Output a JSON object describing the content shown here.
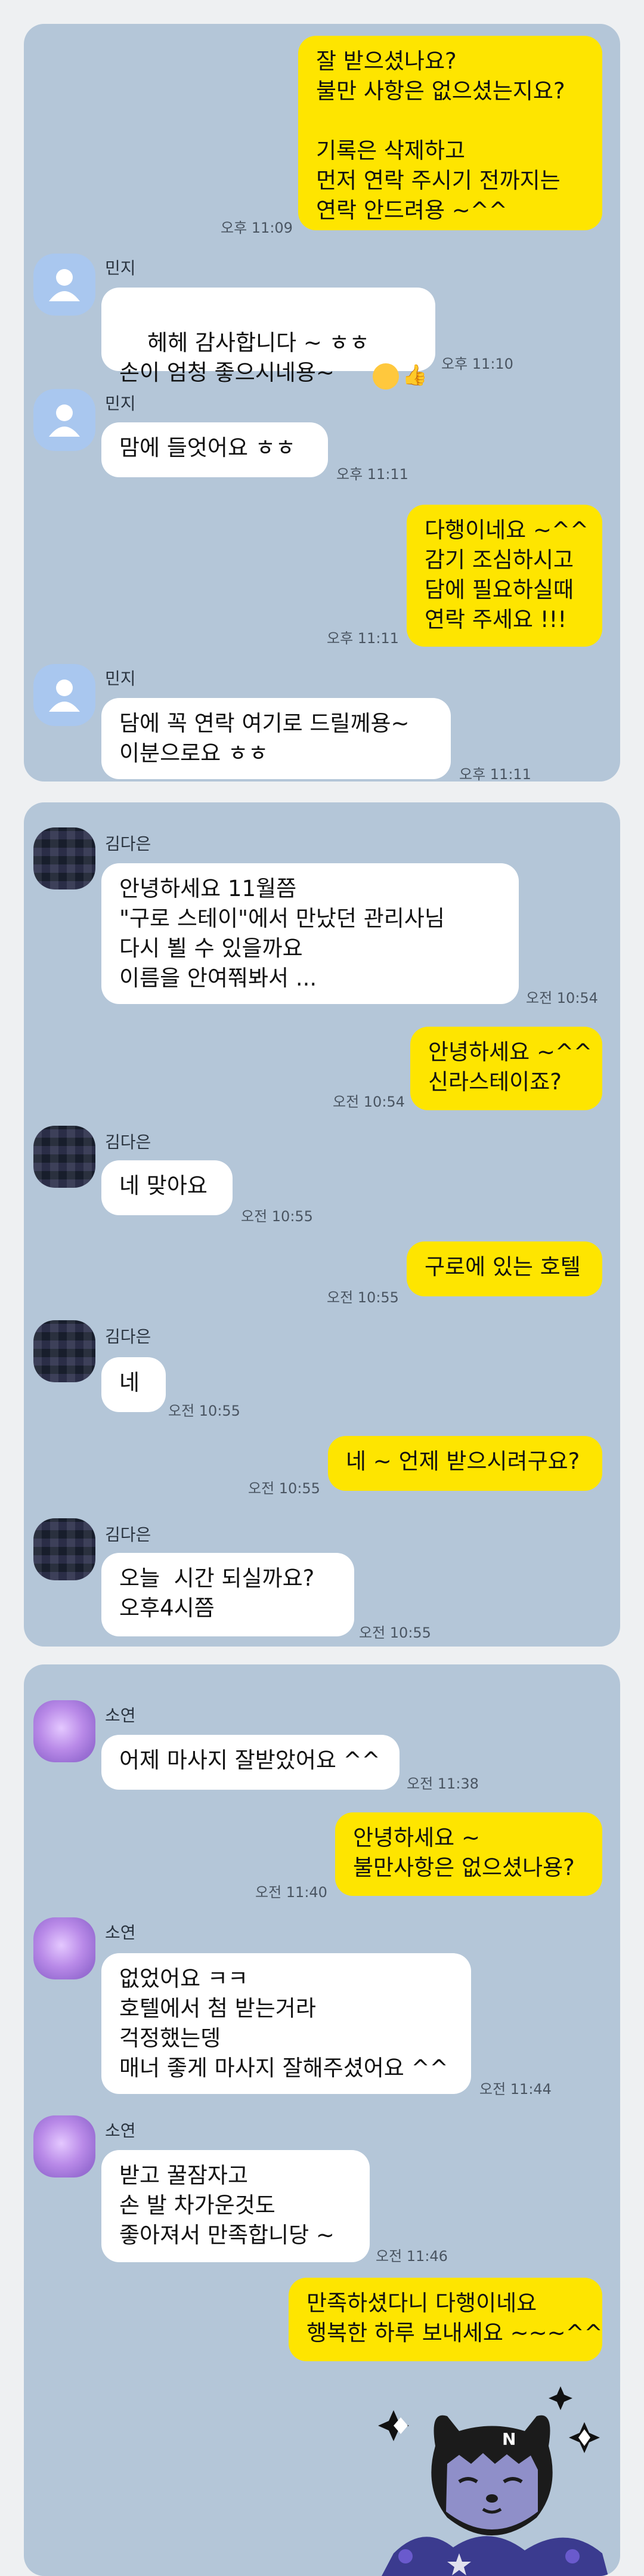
{
  "colors": {
    "panel": "#b4c6d8",
    "my_bubble": "#fee500",
    "their_bubble": "#ffffff"
  },
  "panel1": {
    "msgs": [
      {
        "text": "잘 받으셨나요?\n불만 사항은 없으셨는지요?\n\n기록은 삭제하고\n먼저 연락 주시기 전까지는\n연락 안드려용 ~^^",
        "time": "오후 11:09"
      },
      {
        "name": "민지",
        "text": "헤헤 감사합니다 ~ ㅎㅎ\n손이 엄청 좋으시네용~",
        "time": "오후 11:10"
      },
      {
        "name": "민지",
        "text": "맘에 들엇어요 ㅎㅎ",
        "time": "오후 11:11"
      },
      {
        "text": "다행이네요 ~^^\n감기 조심하시고\n담에 필요하실때\n연락 주세요 !!!",
        "time": "오후 11:11"
      },
      {
        "name": "민지",
        "text": "담에 꼭 연락 여기로 드릴께용~\n이분으로요 ㅎㅎ",
        "time": "오후 11:11"
      }
    ]
  },
  "panel2": {
    "msgs": [
      {
        "name": "김다은",
        "text": "안녕하세요 11월쯤\n\"구로 스테이\"에서 만났던 관리사님\n다시 뵐 수 있을까요\n이름을 안여쭤봐서 ...",
        "time": "오전 10:54"
      },
      {
        "text": "안녕하세요 ~^^\n신라스테이죠?",
        "time": "오전 10:54"
      },
      {
        "name": "김다은",
        "text": "네 맞아요",
        "time": "오전 10:55"
      },
      {
        "text": "구로에 있는 호텔",
        "time": "오전 10:55"
      },
      {
        "name": "김다은",
        "text": "네",
        "time": "오전 10:55"
      },
      {
        "text": "네 ~ 언제 받으시려구요?",
        "time": "오전 10:55"
      },
      {
        "name": "김다은",
        "text": "오늘  시간 되실까요?\n오후4시쯤",
        "time": "오전 10:55"
      }
    ]
  },
  "panel3": {
    "msgs": [
      {
        "name": "소연",
        "text": "어제 마사지 잘받았어요 ^^",
        "time": "오전 11:38"
      },
      {
        "text": "안녕하세요 ~\n불만사항은 없으셨나용?",
        "time": "오전 11:40"
      },
      {
        "name": "소연",
        "text": "없었어요 ㅋㅋ\n호텔에서 첨 받는거라\n걱정했는뎅\n매너 좋게 마사지 잘해주셨어요 ^^",
        "time": "오전 11:44"
      },
      {
        "name": "소연",
        "text": "받고 꿀잠자고\n손 발 차가운것도\n좋아져서 만족합니당 ~",
        "time": "오전 11:46"
      },
      {
        "text": "만족하셨다니 다행이네요\n행복한 하루 보내세요 ~~~^^"
      }
    ]
  }
}
